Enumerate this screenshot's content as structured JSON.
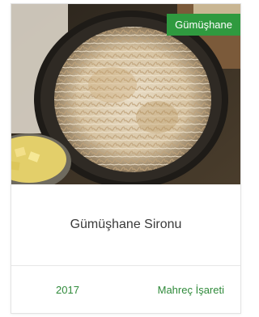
{
  "card": {
    "region_tag": "Gümüşhane",
    "title": "Gümüşhane Sironu",
    "year": "2017",
    "category": "Mahreç İşareti",
    "accent_color": "#2f9a3f",
    "image_icon": "food-photo-baked-dish-in-pan"
  }
}
